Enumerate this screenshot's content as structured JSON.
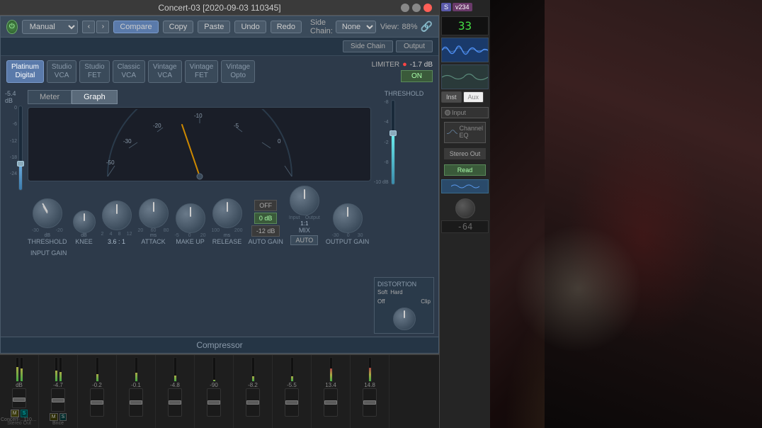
{
  "window": {
    "title": "Concert-03 [2020-09-03 110345]"
  },
  "toolbar": {
    "preset": "Manual",
    "compare_label": "Compare",
    "copy_label": "Copy",
    "paste_label": "Paste",
    "undo_label": "Undo",
    "redo_label": "Redo",
    "sidechain_label": "Side Chain:",
    "sidechain_value": "None",
    "view_label": "View:",
    "view_value": "88%"
  },
  "comp_types": [
    {
      "id": "platinum-digital",
      "label1": "Platinum",
      "label2": "Digital",
      "active": true
    },
    {
      "id": "studio-vca",
      "label1": "Studio",
      "label2": "VCA",
      "active": false
    },
    {
      "id": "studio-fet",
      "label1": "Studio",
      "label2": "FET",
      "active": false
    },
    {
      "id": "classic-vca",
      "label1": "Classic",
      "label2": "VCA",
      "active": false
    },
    {
      "id": "vintage-vca",
      "label1": "Vintage",
      "label2": "VCA",
      "active": false
    },
    {
      "id": "vintage-fet",
      "label1": "Vintage",
      "label2": "FET",
      "active": false
    },
    {
      "id": "vintage-opto",
      "label1": "Vintage",
      "label2": "Opto",
      "active": false
    }
  ],
  "meter": {
    "meter_tab": "Meter",
    "graph_tab": "Graph",
    "active_tab": "graph",
    "input_gain_label": "-5.4 dB",
    "scale_labels": [
      "-50",
      "-30",
      "-20",
      "-10",
      "-5",
      "0"
    ]
  },
  "knobs": {
    "threshold": {
      "label": "THRESHOLD",
      "value": "dB",
      "rotation": "-30"
    },
    "ratio": {
      "label": "3.6 : 1",
      "value": "dB"
    },
    "makeup": {
      "label": "MAKE UP",
      "value": ""
    },
    "auto_gain": {
      "label": "AUTO GAIN"
    },
    "knee": {
      "label": "KNEE",
      "value": "dB"
    },
    "attack": {
      "label": "ATTACK",
      "value": "ms"
    },
    "release": {
      "label": "RELEASE",
      "value": "ms"
    },
    "input_gain": {
      "label": "INPUT GAIN"
    },
    "mix": {
      "label": "MIX",
      "value": "1:1"
    },
    "output_gain": {
      "label": "OUTPUT GAIN"
    }
  },
  "auto_gain_buttons": {
    "off_label": "OFF",
    "db0_label": "0 dB",
    "db_neg12_label": "-12 dB"
  },
  "auto_btn": {
    "label": "AUTO"
  },
  "limiter": {
    "label": "LIMITER",
    "value": "-1.7 dB",
    "on_label": "ON",
    "threshold_label": "THRESHOLD"
  },
  "sidechain_output_buttons": {
    "sidechain_label": "Side Chain",
    "output_label": "Output"
  },
  "distortion": {
    "label": "DISTORTION",
    "options": [
      "Soft",
      "Hard"
    ],
    "off_label": "Off",
    "clip_label": "Clip"
  },
  "plugin_name": "Compressor",
  "daw_right": {
    "s_badge": "S",
    "v_badge": "v234",
    "counter": "33",
    "inst_label": "Inst",
    "aux_label": "Aux",
    "input_label": "Input",
    "channel_eq_label": "Channel EQ",
    "stereo_out_label": "Stereo Out",
    "read_label": "Read"
  },
  "mixer": {
    "channels": [
      {
        "name": "Concert-...110345",
        "db": "dB",
        "sub_label": "Stereo Out",
        "ms_m": "M",
        "ms_s": "S",
        "meter_height": 60
      },
      {
        "name": "Bnce",
        "db": "-4.7",
        "meter_height": 45
      },
      {
        "name": "",
        "db": "-0.2",
        "meter_height": 30
      },
      {
        "name": "",
        "db": "-0.1",
        "meter_height": 35
      },
      {
        "name": "",
        "db": "-4.8",
        "meter_height": 25
      },
      {
        "name": "",
        "db": "-90",
        "meter_height": 5
      },
      {
        "name": "",
        "db": "-8.2",
        "meter_height": 20
      },
      {
        "name": "",
        "db": "-5.5",
        "meter_height": 22
      },
      {
        "name": "",
        "db": "13.4",
        "meter_height": 55
      },
      {
        "name": "",
        "db": "14.8",
        "meter_height": 58
      }
    ]
  }
}
